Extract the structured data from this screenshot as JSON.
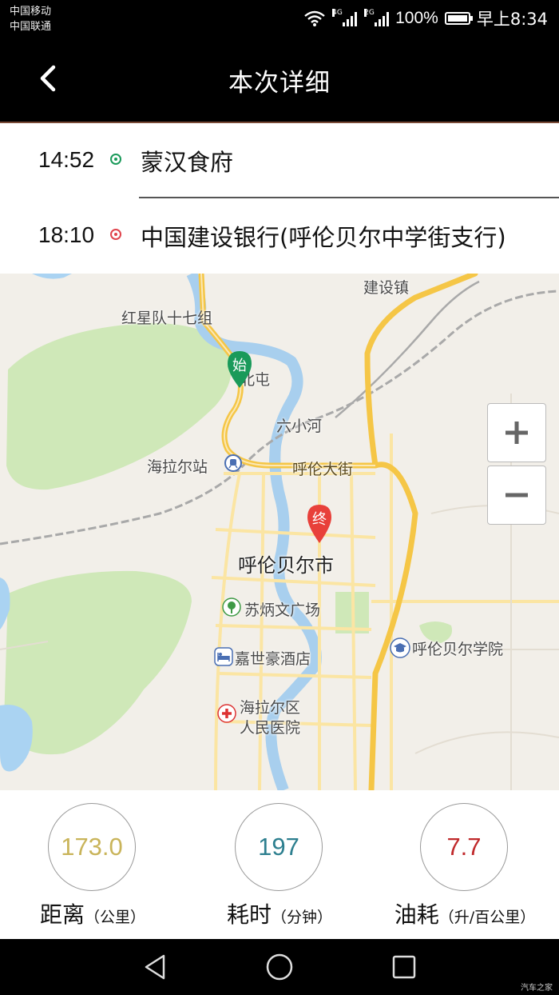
{
  "status_bar": {
    "carrier_1": "中国移动",
    "carrier_2": "中国联通",
    "net_1": "4G",
    "net_2": "2G",
    "battery": "100%",
    "time": "早上8:34"
  },
  "header": {
    "title": "本次详细",
    "back_icon": "chevron-left-icon"
  },
  "route": {
    "start": {
      "time": "14:52",
      "place": "蒙汉食府",
      "color": "#1a9a5a"
    },
    "end": {
      "time": "18:10",
      "place": "中国建设银行(呼伦贝尔中学街支行)",
      "color": "#e0434c"
    }
  },
  "map": {
    "labels": {
      "jianshezhen": "建设镇",
      "hongxing": "红星队十七组",
      "beitun_hidden": "北屯",
      "liuxiaohe": "六小河",
      "hailaer_station": "海拉尔站",
      "hulun_street": "呼伦大街",
      "city": "呼伦贝尔市",
      "subingwen": "苏炳文广场",
      "jiashihao": "嘉世豪酒店",
      "hospital_line1": "海拉尔区",
      "hospital_line2": "人民医院",
      "college": "呼伦贝尔学院"
    },
    "start_marker": "始",
    "end_marker": "终",
    "zoom_in": "+",
    "zoom_out": "−",
    "colors": {
      "start": "#1a9a5a",
      "end": "#e8403a"
    }
  },
  "stats": {
    "distance": {
      "value": "173.0",
      "label": "距离",
      "unit": "（公里）",
      "color": "#c9b45a"
    },
    "duration": {
      "value": "197",
      "label": "耗时",
      "unit": "（分钟）",
      "color": "#2d7f8f"
    },
    "fuel": {
      "value": "7.7",
      "label": "油耗",
      "unit": "（升/百公里）",
      "color": "#c0292b"
    }
  },
  "nav": {
    "back_icon": "triangle-back-icon",
    "home_icon": "circle-home-icon",
    "recent_icon": "square-recent-icon"
  },
  "watermark": "汽车之家"
}
